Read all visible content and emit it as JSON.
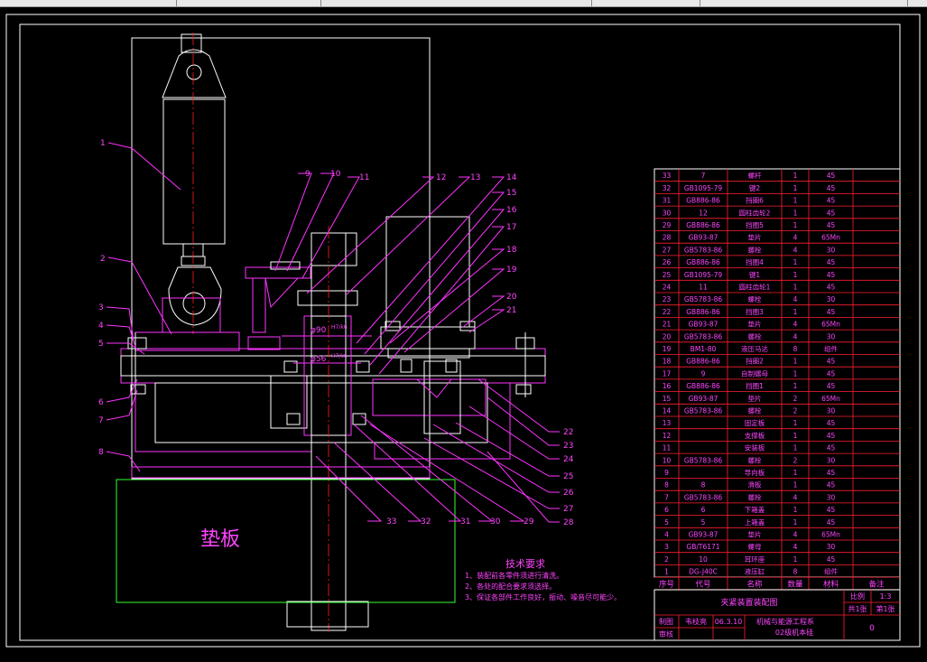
{
  "colors": {
    "background": "#000000",
    "part": "#ff33ff",
    "outline": "#ffffff",
    "centerline": "#ff2020",
    "spacer": "#33ff33",
    "table_line": "#ff2030"
  },
  "callouts": {
    "left": [
      "1",
      "2",
      "3",
      "4",
      "5",
      "6",
      "7",
      "8"
    ],
    "top": [
      "9",
      "10",
      "11",
      "12",
      "13",
      "14",
      "15",
      "16",
      "17",
      "18",
      "19",
      "20",
      "21"
    ],
    "right": [
      "22",
      "23",
      "24",
      "25",
      "26",
      "27",
      "28"
    ],
    "bottom": [
      "33",
      "32",
      "31",
      "30",
      "29"
    ]
  },
  "dims": {
    "d1": "φ90",
    "d1_fit": "H7/k6",
    "d2": "φ56",
    "d2_fit": "H7/k6"
  },
  "spacer_label": "垫板",
  "tech": {
    "title": "技术要求",
    "lines": [
      "1、装配前各零件须进行清洗。",
      "2、各处的配合要求须选择。",
      "3、保证各部件工作良好，振动、噪音尽可能少。"
    ]
  },
  "bom": [
    [
      "33",
      "7",
      "螺杆",
      "1",
      "45",
      ""
    ],
    [
      "32",
      "GB1095-79",
      "键2",
      "1",
      "45",
      ""
    ],
    [
      "31",
      "GB886-86",
      "挡圈6",
      "1",
      "45",
      ""
    ],
    [
      "30",
      "12",
      "圆柱齿轮2",
      "1",
      "45",
      ""
    ],
    [
      "29",
      "GB886-86",
      "挡圈5",
      "1",
      "45",
      ""
    ],
    [
      "28",
      "GB93-87",
      "垫片",
      "4",
      "65Mn",
      ""
    ],
    [
      "27",
      "GB5783-86",
      "螺栓",
      "4",
      "30",
      ""
    ],
    [
      "26",
      "GB886-86",
      "挡圈4",
      "1",
      "45",
      ""
    ],
    [
      "25",
      "GB1095-79",
      "键1",
      "1",
      "45",
      ""
    ],
    [
      "24",
      "11",
      "圆柱齿轮1",
      "1",
      "45",
      ""
    ],
    [
      "23",
      "GB5783-86",
      "螺栓",
      "4",
      "30",
      ""
    ],
    [
      "22",
      "GB886-86",
      "挡圈3",
      "1",
      "45",
      ""
    ],
    [
      "21",
      "GB93-87",
      "垫片",
      "4",
      "65Mn",
      ""
    ],
    [
      "20",
      "GB5783-86",
      "螺栓",
      "4",
      "30",
      ""
    ],
    [
      "19",
      "BM1-80",
      "液压马达",
      "8",
      "组件",
      ""
    ],
    [
      "18",
      "GB886-86",
      "挡圈2",
      "1",
      "45",
      ""
    ],
    [
      "17",
      "9",
      "自制螺母",
      "1",
      "45",
      ""
    ],
    [
      "16",
      "GB886-86",
      "挡圈1",
      "1",
      "45",
      ""
    ],
    [
      "15",
      "GB93-87",
      "垫片",
      "2",
      "65Mn",
      ""
    ],
    [
      "14",
      "GB5783-86",
      "螺栓",
      "2",
      "30",
      ""
    ],
    [
      "13",
      "",
      "固定板",
      "1",
      "45",
      ""
    ],
    [
      "12",
      "",
      "支撑板",
      "1",
      "45",
      ""
    ],
    [
      "11",
      "",
      "安装板",
      "1",
      "45",
      ""
    ],
    [
      "10",
      "GB5783-86",
      "螺栓",
      "2",
      "30",
      ""
    ],
    [
      "9",
      "",
      "导向板",
      "1",
      "45",
      ""
    ],
    [
      "8",
      "8",
      "滑板",
      "1",
      "45",
      ""
    ],
    [
      "7",
      "GB5783-86",
      "螺栓",
      "4",
      "30",
      ""
    ],
    [
      "6",
      "6",
      "下箱盖",
      "1",
      "45",
      ""
    ],
    [
      "5",
      "5",
      "上箱盖",
      "1",
      "45",
      ""
    ],
    [
      "4",
      "GB93-87",
      "垫片",
      "4",
      "65Mn",
      ""
    ],
    [
      "3",
      "GB/T6171",
      "螺母",
      "4",
      "30",
      ""
    ],
    [
      "2",
      "10",
      "耳环座",
      "1",
      "45",
      ""
    ],
    [
      "1",
      "DG-J40C",
      "液压缸",
      "8",
      "组件",
      ""
    ]
  ],
  "bom_header": [
    "序号",
    "代号",
    "名称",
    "数量",
    "材料",
    "备注"
  ],
  "title_block": {
    "drawing_name": "夹紧装置装配图",
    "scale_label": "比例",
    "scale": "1:3",
    "sheets_total": "共1张",
    "sheet_no": "第1张",
    "drawn_label": "制图",
    "drawn_by": "韦枝亮",
    "date": "06.3.10",
    "checked_label": "审核",
    "school": "机械与能源工程系",
    "class_name": "02级机本硅",
    "drawing_no": "0"
  }
}
